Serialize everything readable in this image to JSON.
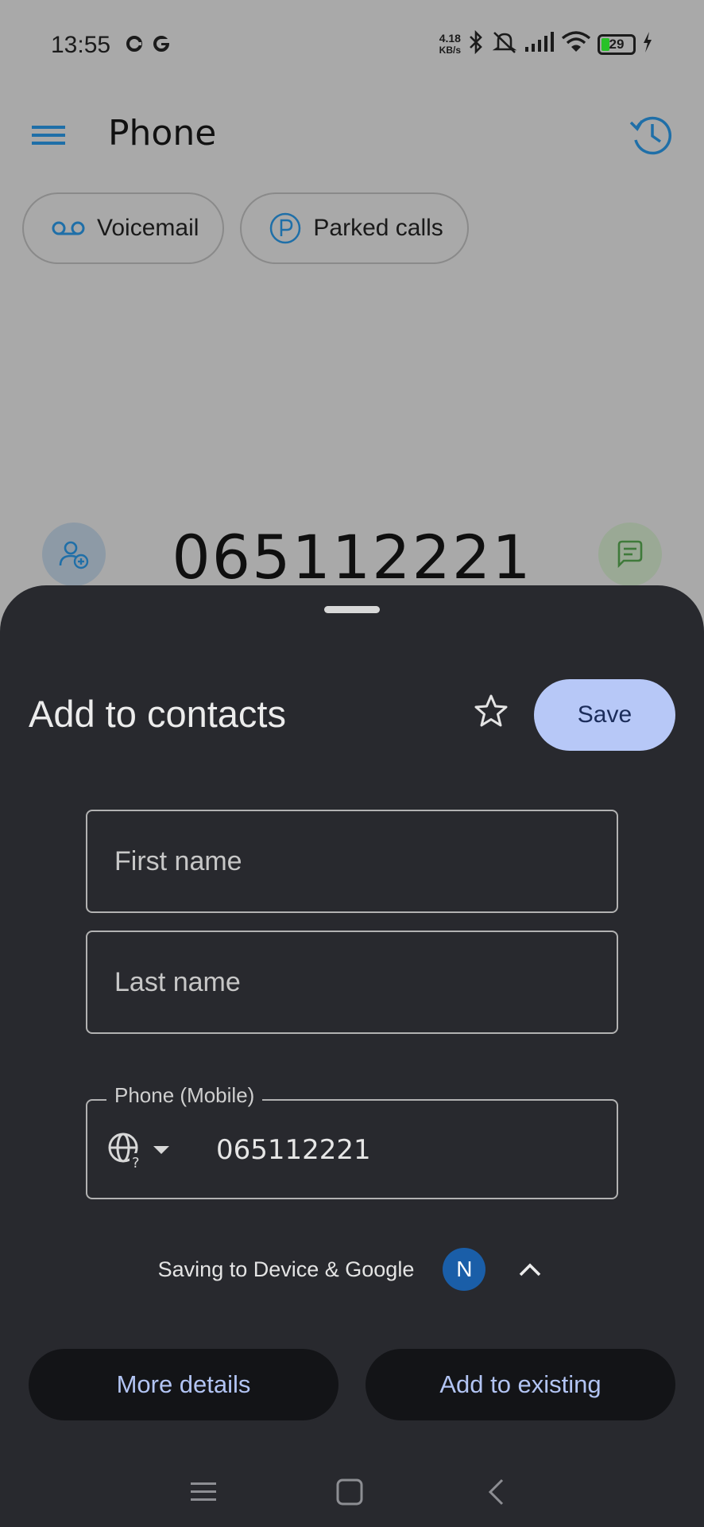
{
  "status_bar": {
    "time": "13:55",
    "net_speed_value": "4.18",
    "net_speed_unit": "KB/s",
    "battery_level": "29"
  },
  "app_bar": {
    "title": "Phone",
    "menu_icon": "hamburger-menu-icon",
    "history_icon": "call-history-icon"
  },
  "chips": [
    {
      "label": "Voicemail",
      "icon": "voicemail-icon"
    },
    {
      "label": "Parked calls",
      "icon": "parked-calls-icon"
    }
  ],
  "dialer": {
    "number": "065112221"
  },
  "sheet": {
    "title": "Add to contacts",
    "save_label": "Save",
    "first_name_placeholder": "First name",
    "last_name_placeholder": "Last name",
    "phone_label": "Phone (Mobile)",
    "phone_value": "065112221",
    "saving_text": "Saving to Device & Google",
    "account_initial": "N",
    "more_details_label": "More details",
    "add_existing_label": "Add to existing"
  },
  "colors": {
    "sheet_background": "#28292e",
    "save_button": "#b7c8f7",
    "account_avatar": "#1a5ea8",
    "accent_blue": "#1f6fa8"
  }
}
